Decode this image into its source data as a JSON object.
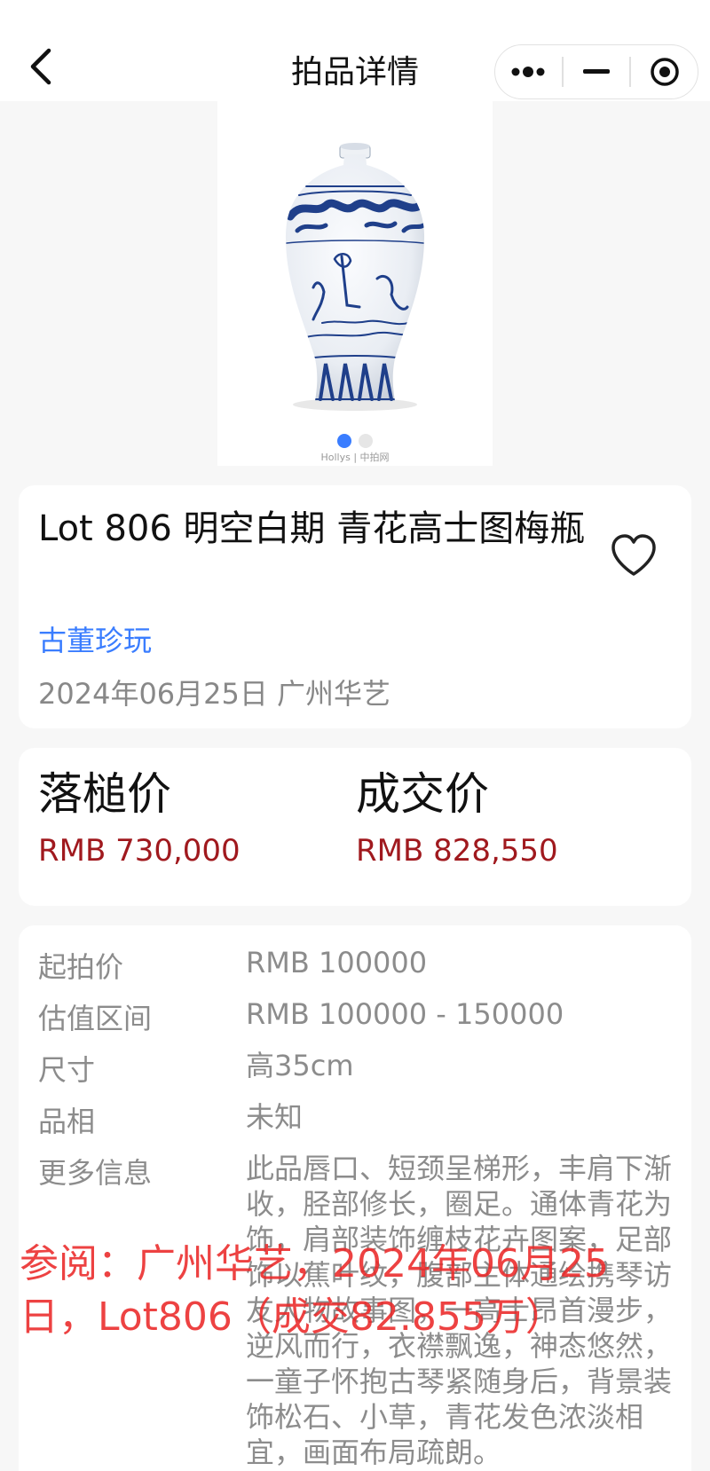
{
  "header": {
    "title": "拍品详情",
    "back_icon": "chevron-left-icon",
    "capsule_icons": [
      "more-dots-icon",
      "minimize-icon",
      "target-icon"
    ]
  },
  "gallery": {
    "watermark": "Hollys | 中拍网",
    "slide_count": 2,
    "active_index": 0
  },
  "lot": {
    "title": "Lot 806 明空白期 青花高士图梅瓶",
    "category": "古董珍玩",
    "date_house": "2024年06月25日 广州华艺"
  },
  "prices": {
    "hammer_label": "落槌价",
    "hammer_value": "RMB 730,000",
    "deal_label": "成交价",
    "deal_value": "RMB 828,550"
  },
  "details": [
    {
      "label": "起拍价",
      "value": "RMB 100000"
    },
    {
      "label": "估值区间",
      "value": "RMB 100000 - 150000"
    },
    {
      "label": "尺寸",
      "value": "高35cm"
    },
    {
      "label": "品相",
      "value": "未知"
    },
    {
      "label": "更多信息",
      "value": "此品唇口、短颈呈梯形，丰肩下渐收，胫部修长，圈足。通体青花为饰，肩部装饰缠枝花卉图案，足部饰以蕉叶纹，腹部主体通绘携琴访友人物故事图，一高士昂首漫步，逆风而行，衣襟飘逸，神态悠然，一童子怀抱古琴紧随身后，背景装饰松石、小草，青花发色浓淡相宜，画面布局疏朗。"
    }
  ],
  "overlay": {
    "text": "参阅：广州华艺，2024年06月25日，Lot806（成交82.855万）"
  },
  "colors": {
    "accent": "#3a7dff",
    "price": "#a0191e",
    "overlay": "#eb2828",
    "muted": "#8c8c8c"
  }
}
